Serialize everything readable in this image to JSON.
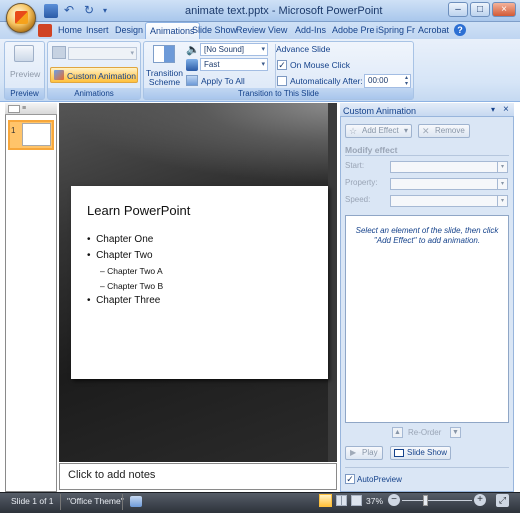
{
  "window": {
    "title": "animate text.pptx - Microsoft PowerPoint",
    "minimize": "–",
    "maximize": "□",
    "close": "×"
  },
  "tabs": [
    "Home",
    "Insert",
    "Design",
    "Animations",
    "Slide Show",
    "Review",
    "View",
    "Add-Ins",
    "Adobe Pre",
    "iSpring Fr",
    "Acrobat"
  ],
  "active_tab": "Animations",
  "ribbon": {
    "preview_group": {
      "button": "Preview",
      "label": "Preview"
    },
    "animations_group": {
      "custom_animation": "Custom Animation",
      "label": "Animations"
    },
    "transition_group": {
      "scheme_button": "Transition Scheme",
      "sound": "[No Sound]",
      "speed": "Fast",
      "apply_to_all": "Apply To All",
      "advance_slide": "Advance Slide",
      "on_mouse_click": "On Mouse Click",
      "on_mouse_click_checked": true,
      "automatically_after": "Automatically After:",
      "automatically_after_checked": false,
      "time": "00:00",
      "label": "Transition to This Slide"
    }
  },
  "slide": {
    "title": "Learn PowerPoint",
    "bullets": [
      "Chapter One",
      "Chapter Two",
      "Chapter Three"
    ],
    "sub_bullets": [
      "Chapter Two A",
      "Chapter Two B"
    ],
    "number": "1"
  },
  "notes": {
    "placeholder": "Click to add notes"
  },
  "custom_animation_pane": {
    "title": "Custom Animation",
    "add_effect": "Add Effect",
    "remove": "Remove",
    "modify_effect": "Modify effect",
    "start_label": "Start:",
    "property_label": "Property:",
    "speed_label": "Speed:",
    "hint": "Select an element of the slide, then click \"Add Effect\" to add animation.",
    "reorder": "Re-Order",
    "play": "Play",
    "slide_show": "Slide Show",
    "autopreview": "AutoPreview",
    "autopreview_checked": true
  },
  "status": {
    "slide": "Slide 1 of 1",
    "theme": "\"Office Theme\"",
    "zoom": "37%"
  }
}
